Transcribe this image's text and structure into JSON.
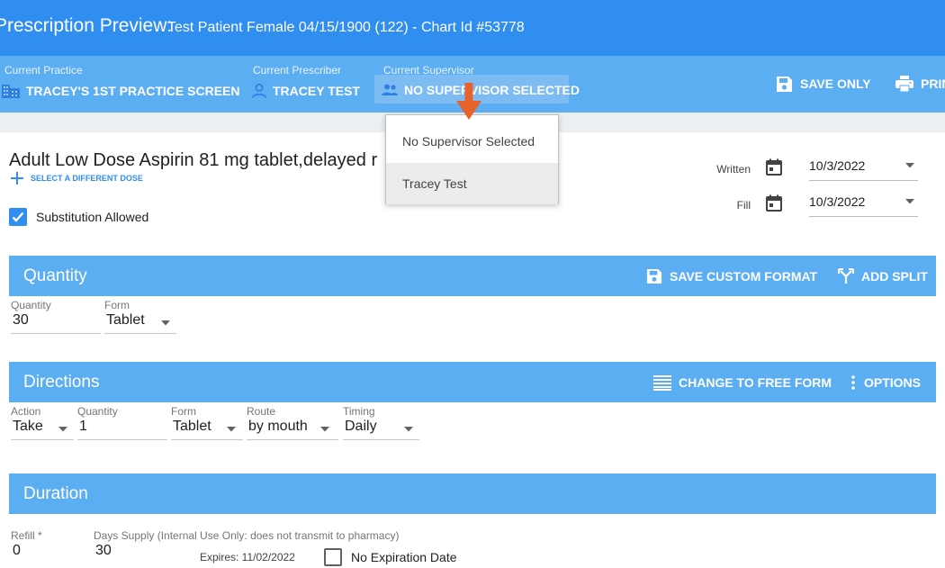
{
  "header": {
    "title": "Prescription Preview:",
    "patient": "Test Patient Female 04/15/1900 (122) - Chart Id #53778"
  },
  "context": {
    "practice_label": "Current Practice",
    "practice_value": "TRACEY'S 1ST PRACTICE SCREEN",
    "prescriber_label": "Current Prescriber",
    "prescriber_value": "TRACEY TEST",
    "supervisor_label": "Current Supervisor",
    "supervisor_value": "NO SUPERVISOR SELECTED",
    "save_only": "SAVE ONLY",
    "print": "PRINT"
  },
  "supervisor_menu": {
    "options": [
      "No Supervisor Selected",
      "Tracey Test"
    ]
  },
  "drug": {
    "name": "Adult Low Dose Aspirin 81 mg tablet,delayed r",
    "select_dose": "SELECT A DIFFERENT DOSE",
    "substitution_label": "Substitution Allowed",
    "substitution_checked": true
  },
  "dates": {
    "written_label": "Written",
    "written_value": "10/3/2022",
    "fill_label": "Fill",
    "fill_value": "10/3/2022"
  },
  "quantity": {
    "title": "Quantity",
    "save_custom": "SAVE CUSTOM FORMAT",
    "add_split": "ADD SPLIT",
    "quantity_label": "Quantity",
    "quantity_value": "30",
    "form_label": "Form",
    "form_value": "Tablet"
  },
  "directions": {
    "title": "Directions",
    "change_free_form": "CHANGE TO FREE FORM",
    "options": "OPTIONS",
    "action_label": "Action",
    "action_value": "Take",
    "quantity_label": "Quantity",
    "quantity_value": "1",
    "form_label": "Form",
    "form_value": "Tablet",
    "route_label": "Route",
    "route_value": "by mouth",
    "timing_label": "Timing",
    "timing_value": "Daily"
  },
  "duration": {
    "title": "Duration",
    "refill_label": "Refill *",
    "refill_value": "0",
    "days_label": "Days Supply (Internal Use Only: does not transmit to pharmacy)",
    "days_value": "30",
    "expires": "Expires: 11/02/2022",
    "no_expiration_label": "No Expiration Date",
    "no_expiration_checked": false
  },
  "colors": {
    "title_bar": "#2f8ef0",
    "context_bar": "#5caef3",
    "section_header": "#5caef3",
    "annotation_arrow": "#e8622c"
  }
}
